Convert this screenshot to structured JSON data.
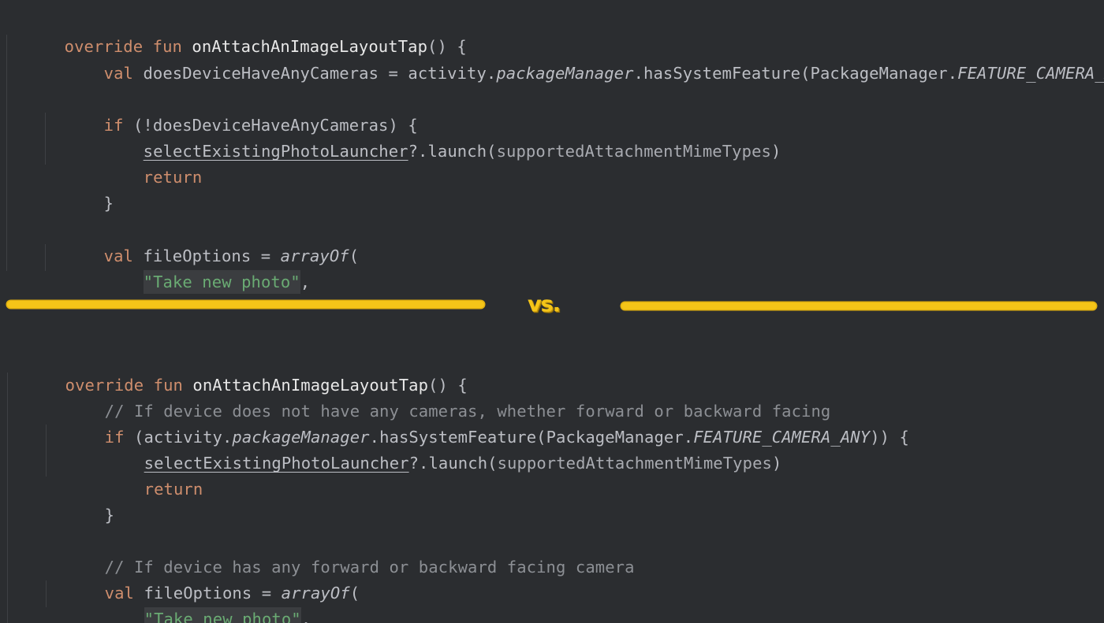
{
  "top_code": {
    "line1": {
      "kw1": "override fun ",
      "fn": "onAttachAnImageLayoutTap",
      "tail": "() {"
    },
    "line2": {
      "kw": "val ",
      "var": "doesDeviceHaveAnyCameras = ",
      "obj": "activity.",
      "prop": "packageManager",
      "call": ".hasSystemFeature(",
      "cls": "PackageManager.",
      "const": "FEATURE_CAMERA_ANY",
      "tail": ")"
    },
    "line3": {
      "kw": "if ",
      "cond": "(!doesDeviceHaveAnyCameras) {"
    },
    "line4": {
      "ref": "selectExistingPhotoLauncher",
      "call": "?.launch(",
      "arg": "supportedAttachmentMimeTypes",
      "tail": ")"
    },
    "line5": {
      "kw": "return"
    },
    "line6": {
      "text": "}"
    },
    "line7": {
      "kw": "val ",
      "var": "fileOptions = ",
      "fn": "arrayOf",
      "tail": "("
    },
    "line8": {
      "str": "\"Take new photo\"",
      "tail": ","
    }
  },
  "divider": {
    "label": "vs.",
    "accent_color": "#f5c518"
  },
  "bottom_code": {
    "line1": {
      "kw1": "override fun ",
      "fn": "onAttachAnImageLayoutTap",
      "tail": "() {"
    },
    "line2": {
      "comment": "// If device does not have any cameras, whether forward or backward facing"
    },
    "line3": {
      "kw": "if ",
      "open": "(",
      "obj": "activity.",
      "prop": "packageManager",
      "call": ".hasSystemFeature(",
      "cls": "PackageManager.",
      "const": "FEATURE_CAMERA_ANY",
      "tail": ")) {"
    },
    "line4": {
      "ref": "selectExistingPhotoLauncher",
      "call": "?.launch(",
      "arg": "supportedAttachmentMimeTypes",
      "tail": ")"
    },
    "line5": {
      "kw": "return"
    },
    "line6": {
      "text": "}"
    },
    "line7": {
      "comment": "// If device has any forward or backward facing camera"
    },
    "line8": {
      "kw": "val ",
      "var": "fileOptions = ",
      "fn": "arrayOf",
      "tail": "("
    },
    "line9": {
      "str": "\"Take new photo\"",
      "tail": ","
    }
  }
}
